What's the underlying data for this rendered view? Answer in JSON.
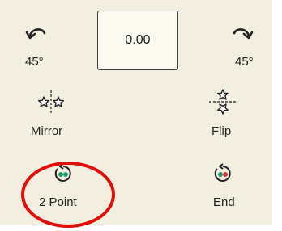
{
  "rotate": {
    "left_label": "45°",
    "right_label": "45°",
    "angle_value": "0.00"
  },
  "tools": {
    "mirror_label": "Mirror",
    "flip_label": "Flip",
    "two_point_label": "2 Point",
    "end_label": "End"
  },
  "colors": {
    "panel_bg": "#f3efe0",
    "highlight": "#e10e0e",
    "two_point_dot": "#1e9a6e",
    "end_dot_left": "#1e9a6e",
    "end_dot_right": "#d23a3a"
  },
  "icons": {
    "rotate_left": "rotate-ccw-icon",
    "rotate_right": "rotate-cw-icon",
    "mirror": "mirror-stars-icon",
    "flip": "flip-stars-icon",
    "two_point": "two-point-rotate-icon",
    "end": "end-rotate-icon"
  }
}
